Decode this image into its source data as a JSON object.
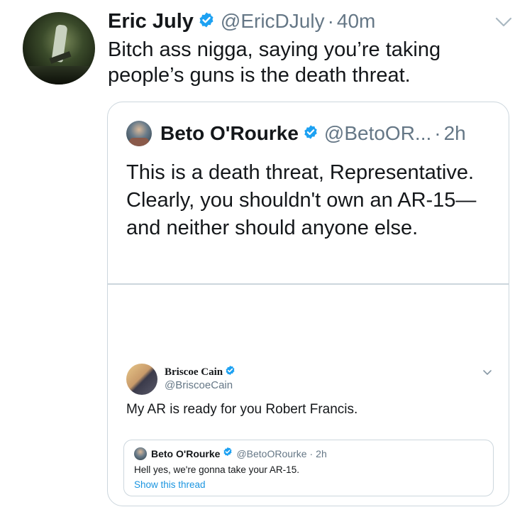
{
  "tweet": {
    "author_name": "Eric July",
    "author_handle": "@EricDJuly",
    "separator": "·",
    "time": "40m",
    "text": "Bitch ass nigga, saying you’re taking people’s guns is the death threat."
  },
  "quoted_tweet": {
    "author_name": "Beto O'Rourke",
    "author_handle": "@BetoOR...",
    "separator": "·",
    "time": "2h",
    "text": "This is a death threat, Representative. Clearly, you shouldn't own an AR-15—and neither should anyone else."
  },
  "embedded_tweet": {
    "author_name": "Briscoe Cain",
    "author_handle": "@BriscoeCain",
    "text": "My AR is ready for you Robert Francis.",
    "inner_quote": {
      "author_name": "Beto O'Rourke",
      "author_handle": "@BetoORourke",
      "separator": "·",
      "time": "2h",
      "text": "Hell yes, we're gonna take your AR-15.",
      "link": "Show this thread"
    }
  },
  "colors": {
    "verified": "#1da1f2",
    "secondary_text": "#657786",
    "link": "#1b95e0",
    "border": "#ccd6dd"
  },
  "icons": {
    "verified": "verified-badge-icon",
    "chevron": "chevron-down-icon"
  }
}
